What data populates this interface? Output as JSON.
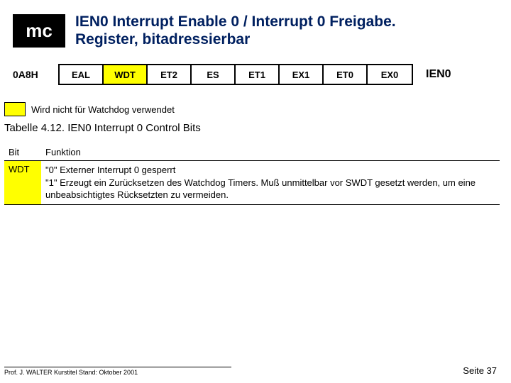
{
  "header": {
    "badge": "mc",
    "title": "IEN0 Interrupt Enable 0 / Interrupt 0 Freigabe.\nRegister, bitadressierbar"
  },
  "register": {
    "address": "0A8H",
    "name": "IEN0",
    "bits": [
      {
        "label": "EAL",
        "hl": false
      },
      {
        "label": "WDT",
        "hl": true
      },
      {
        "label": "ET2",
        "hl": false
      },
      {
        "label": "ES",
        "hl": false
      },
      {
        "label": "ET1",
        "hl": false
      },
      {
        "label": "EX1",
        "hl": false
      },
      {
        "label": "ET0",
        "hl": false
      },
      {
        "label": "EX0",
        "hl": false
      }
    ]
  },
  "legend": "Wird nicht für Watchdog verwendet",
  "table": {
    "title": "Tabelle 4.12. IEN0 Interrupt 0 Control Bits",
    "headers": {
      "bit": "Bit",
      "func": "Funktion"
    },
    "rows": [
      {
        "bit": "WDT",
        "func": "\"0\" Externer Interrupt 0 gesperrt\n\"1\" Erzeugt ein Zurücksetzen des Watchdog Timers. Muß unmittelbar vor SWDT gesetzt werden, um eine unbeabsichtigtes Rücksetzten zu vermeiden."
      }
    ]
  },
  "footer": {
    "left": "Prof. J. WALTER   Kurstitel Stand: Oktober 2001",
    "right": "Seite 37"
  }
}
